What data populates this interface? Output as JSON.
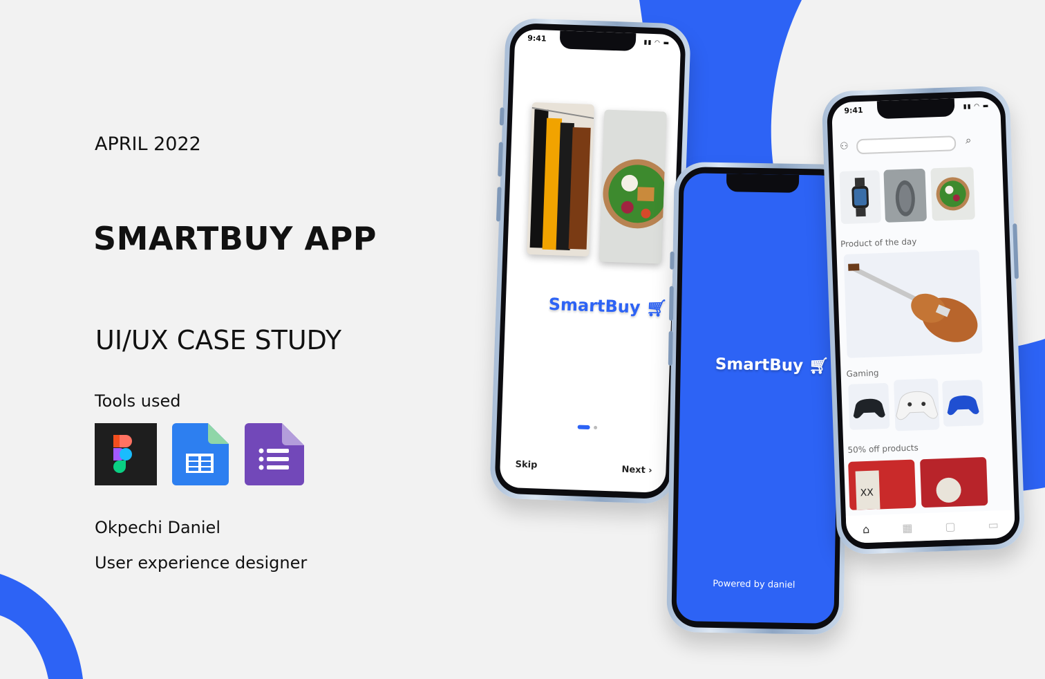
{
  "date": "APRIL 2022",
  "title": "SMARTBUY APP",
  "subtitle": "UI/UX CASE STUDY",
  "tools_label": "Tools used",
  "tools": [
    "figma-icon",
    "google-sheets-icon",
    "google-forms-icon"
  ],
  "author": "Okpechi Daniel",
  "role": "User experience designer",
  "colors": {
    "accent": "#2d63f5",
    "background": "#f2f2f2"
  },
  "phone_onboarding": {
    "time": "9:41",
    "brand": "SmartBuy",
    "skip_label": "Skip",
    "next_label": "Next"
  },
  "phone_splash": {
    "brand": "SmartBuy",
    "powered_by": "Powered by daniel"
  },
  "phone_home": {
    "time": "9:41",
    "section_product_of_day": "Product of the day",
    "section_gaming": "Gaming",
    "section_off": "50% off products"
  }
}
